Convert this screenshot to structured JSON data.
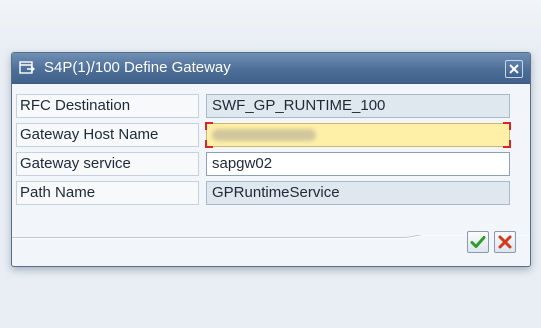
{
  "dialog": {
    "title": "S4P(1)/100 Define Gateway",
    "title_icon": "dialog-window-icon",
    "close_icon": "close-icon"
  },
  "fields": [
    {
      "label": "RFC Destination",
      "value": "SWF_GP_RUNTIME_100",
      "editable": false
    },
    {
      "label": "Gateway Host Name",
      "value": "",
      "editable": true,
      "focused": true,
      "blurred": true
    },
    {
      "label": "Gateway service",
      "value": "sapgw02",
      "editable": true
    },
    {
      "label": "Path Name",
      "value": "GPRuntimeService",
      "editable": false
    }
  ],
  "buttons": {
    "ok_icon": "checkmark-icon",
    "cancel_icon": "cancel-x-icon"
  },
  "colors": {
    "titlebar": "#4d6e97",
    "focus_field": "#fff0a8",
    "focus_corners": "#d9262c",
    "ok_green": "#2e9c25",
    "cancel_red": "#d23a1b"
  }
}
